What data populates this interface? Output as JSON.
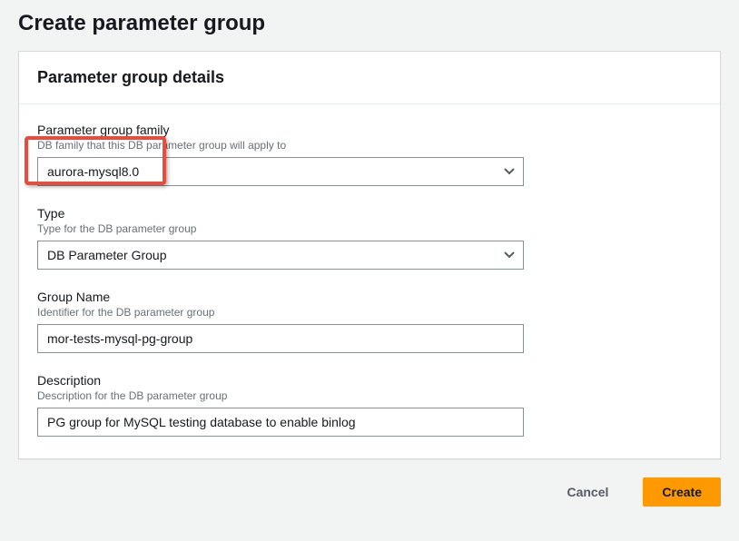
{
  "page": {
    "title": "Create parameter group"
  },
  "panel": {
    "title": "Parameter group details"
  },
  "fields": {
    "family": {
      "label": "Parameter group family",
      "hint": "DB family that this DB parameter group will apply to",
      "value": "aurora-mysql8.0"
    },
    "type": {
      "label": "Type",
      "hint": "Type for the DB parameter group",
      "value": "DB Parameter Group"
    },
    "groupName": {
      "label": "Group Name",
      "hint": "Identifier for the DB parameter group",
      "value": "mor-tests-mysql-pg-group"
    },
    "description": {
      "label": "Description",
      "hint": "Description for the DB parameter group",
      "value": "PG group for MySQL testing database to enable binlog"
    }
  },
  "actions": {
    "cancel": "Cancel",
    "create": "Create"
  }
}
